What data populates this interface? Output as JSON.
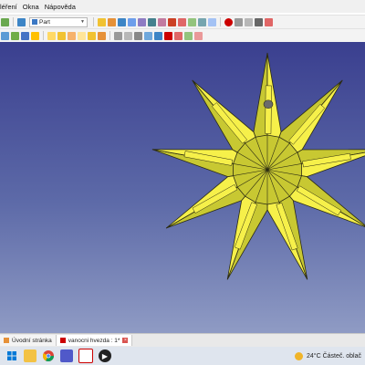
{
  "menubar": {
    "items": [
      "léření",
      "Okna",
      "Nápověda"
    ]
  },
  "toolbar": {
    "workbench_value": "Part"
  },
  "document_tabs": [
    {
      "label": "Úvodní stránka"
    },
    {
      "label": "vanocni hvezda : 1*"
    }
  ],
  "taskbar": {
    "weather": "24°C  Částeč. oblač"
  },
  "colors": {
    "viewport_top": "#3a3f8f",
    "viewport_bottom": "#8f9bc4",
    "star_fill": "#c8c832",
    "star_highlight": "#f6f04a",
    "star_stroke": "#2b2b12"
  },
  "icons": [
    "new-file-icon",
    "open-icon",
    "save-icon",
    "undo-icon",
    "redo-icon",
    "refresh-icon",
    "macro-record-icon",
    "workbench-icon",
    "view-isometric-icon",
    "view-front-icon",
    "view-top-icon",
    "box-icon",
    "cylinder-icon",
    "sphere-icon",
    "cone-icon",
    "boolean-icon",
    "measure-icon",
    "close-tab-icon",
    "windows-start-icon",
    "chrome-icon",
    "freecad-icon",
    "media-icon"
  ]
}
